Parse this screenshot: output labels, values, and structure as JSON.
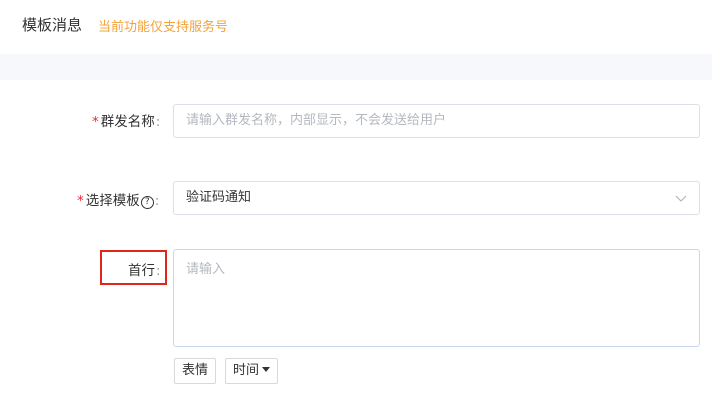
{
  "header": {
    "title": "模板消息",
    "note": "当前功能仅支持服务号"
  },
  "form": {
    "name_field": {
      "required_mark": "*",
      "label": "群发名称",
      "colon": ":",
      "placeholder": "请输入群发名称，内部显示，不会发送给用户"
    },
    "template_field": {
      "required_mark": "*",
      "label": "选择模板",
      "help_icon": "?",
      "colon": ":",
      "value": "验证码通知"
    },
    "first_line_field": {
      "label": "首行",
      "colon": ":",
      "placeholder": "请输入"
    },
    "toolbar": {
      "emoji_label": "表情",
      "time_label": "时间"
    }
  },
  "colors": {
    "note": "#f3a33a",
    "required": "#f5222d",
    "highlight": "#e0251b"
  }
}
